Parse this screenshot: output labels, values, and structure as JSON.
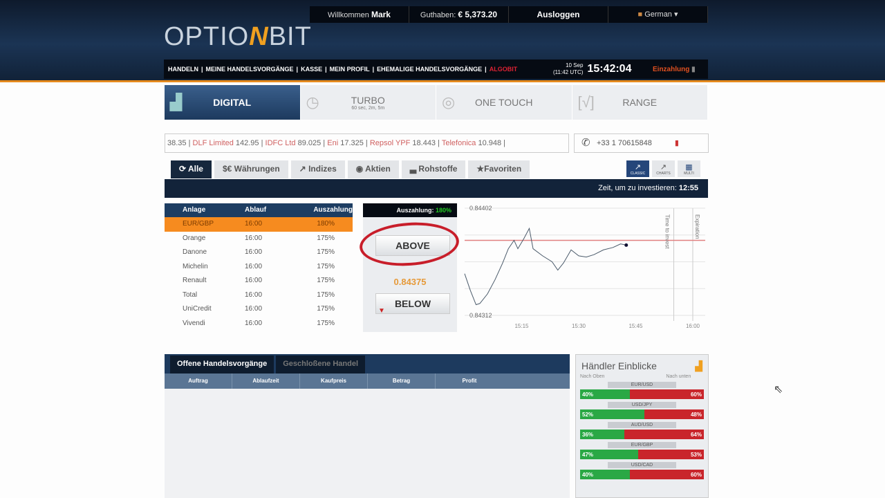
{
  "header": {
    "logo": "OPTIONBIT",
    "welcome_label": "Willkommen",
    "user": "Mark",
    "balance_label": "Guthaben:",
    "balance": "€ 5,373.20",
    "logout": "Ausloggen",
    "language": "German",
    "nav": [
      "HANDELN",
      "MEINE HANDELSVORGÄNGE",
      "KASSE",
      "MEIN PROFIL",
      "EHEMALIGE HANDELSVORGÄNGE"
    ],
    "nav_highlight": "ALGOBIT",
    "date": "10 Sep",
    "utc": "(11:42 UTC)",
    "time": "15:42:04",
    "deposit": "Einzahlung"
  },
  "option_tabs": [
    {
      "label": "DIGITAL",
      "sub": ""
    },
    {
      "label": "TURBO",
      "sub": "60 sec, 2m, 5m"
    },
    {
      "label": "ONE TOUCH",
      "sub": ""
    },
    {
      "label": "RANGE",
      "sub": ""
    }
  ],
  "ticker": [
    {
      "name": "",
      "value": "38.35"
    },
    {
      "name": "DLF Limited",
      "value": "142.95"
    },
    {
      "name": "IDFC Ltd",
      "value": "89.025"
    },
    {
      "name": "Eni",
      "value": "17.325"
    },
    {
      "name": "Repsol YPF",
      "value": "18.443"
    },
    {
      "name": "Telefonica",
      "value": "10.948"
    }
  ],
  "phone": "+33 1 70615848",
  "categories": [
    "Alle",
    "Währungen",
    "Indizes",
    "Aktien",
    "Rohstoffe",
    "Favoriten"
  ],
  "views": [
    "CLASSIC",
    "CHARTS",
    "MULTI"
  ],
  "invest_time_label": "Zeit, um zu investieren:",
  "invest_time": "12:55",
  "assets": {
    "headers": [
      "Anlage",
      "Ablauf",
      "Auszahlung"
    ],
    "rows": [
      [
        "EUR/GBP",
        "16:00",
        "180%"
      ],
      [
        "Orange",
        "16:00",
        "175%"
      ],
      [
        "Danone",
        "16:00",
        "175%"
      ],
      [
        "Michelin",
        "16:00",
        "175%"
      ],
      [
        "Renault",
        "16:00",
        "175%"
      ],
      [
        "Total",
        "16:00",
        "175%"
      ],
      [
        "UniCredit",
        "16:00",
        "175%"
      ],
      [
        "Vivendi",
        "16:00",
        "175%"
      ]
    ]
  },
  "trade": {
    "payout_label": "Auszahlung:",
    "payout": "180%",
    "above": "ABOVE",
    "below": "BELOW",
    "price": "0.84375"
  },
  "chart_data": {
    "type": "line",
    "ylim": [
      0.84312,
      0.84402
    ],
    "y_labels": [
      "0.84402",
      "0.84312"
    ],
    "x_ticks": [
      "15:15",
      "15:30",
      "15:45",
      "16:00"
    ],
    "x_tick_minutes": [
      15,
      30,
      45,
      60
    ],
    "xlim_minutes": [
      0,
      60
    ],
    "x_minutes": [
      0,
      1.5,
      3,
      4,
      6,
      8,
      10,
      11.5,
      13,
      14,
      15.5,
      17,
      18,
      20.5,
      23,
      24.5,
      26,
      28,
      30,
      32,
      34,
      36.5,
      39,
      41,
      42.5
    ],
    "y": [
      0.84347,
      0.84333,
      0.84321,
      0.84322,
      0.8433,
      0.84342,
      0.84356,
      0.84368,
      0.84375,
      0.84368,
      0.84376,
      0.84385,
      0.84368,
      0.84362,
      0.84357,
      0.8435,
      0.84356,
      0.84367,
      0.84362,
      0.84361,
      0.84363,
      0.84367,
      0.84369,
      0.84372,
      0.84371
    ],
    "strike": 0.84375,
    "time_to_invest_label": "Time to invest",
    "time_to_invest_minute": 55,
    "expiration_label": "Expiration",
    "expiration_minute": 60
  },
  "bottom": {
    "tabs": [
      "Offene Handelsvorgänge",
      "Geschloßene Handel"
    ],
    "headers": [
      "Auftrag",
      "Ablaufzeit",
      "Kaufpreis",
      "Betrag",
      "Profit"
    ]
  },
  "insights": {
    "title": "Händler Einblicke",
    "up_label": "Nach Oben",
    "down_label": "Nach unten",
    "pairs": [
      {
        "name": "EUR/USD",
        "up": 40,
        "down": 60,
        "up_text": "40%",
        "down_text": "60%"
      },
      {
        "name": "USD/JPY",
        "up": 52,
        "down": 48,
        "up_text": "52%",
        "down_text": "48%"
      },
      {
        "name": "AUD/USD",
        "up": 36,
        "down": 64,
        "up_text": "36%",
        "down_text": "64%"
      },
      {
        "name": "EUR/GBP",
        "up": 47,
        "down": 53,
        "up_text": "47%",
        "down_text": "53%"
      },
      {
        "name": "USD/CAD",
        "up": 40,
        "down": 60,
        "up_text": "40%",
        "down_text": "60%"
      }
    ]
  }
}
